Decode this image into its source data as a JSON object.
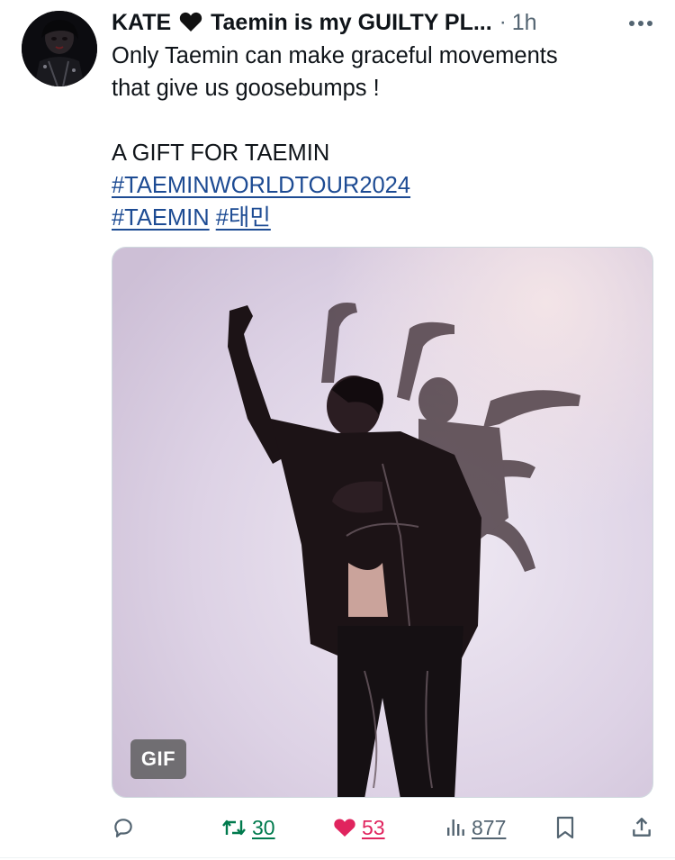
{
  "tweet": {
    "author_name_prefix": "KATE",
    "author_name_suffix": "Taemin is my GUILTY PL...",
    "separator": "·",
    "time": "1h",
    "text_line1": "Only Taemin can make graceful movements",
    "text_line2": "that give us goosebumps !",
    "text_line3": "A GIFT FOR TAEMIN",
    "hashtags": [
      "#TAEMINWORLDTOUR2024",
      "#TAEMIN",
      "#태민"
    ],
    "media_badge": "GIF"
  },
  "actions": {
    "replies": "",
    "retweets": "30",
    "likes": "53",
    "views": "877"
  },
  "icons": {
    "avatar": "avatar-image",
    "heart_emoji": "black-heart-icon",
    "more": "more-options-icon",
    "reply": "reply-icon",
    "retweet": "retweet-icon",
    "like": "heart-icon",
    "views": "views-icon",
    "bookmark": "bookmark-icon",
    "share": "share-icon"
  },
  "colors": {
    "hashtag": "#1d4b93",
    "retweet_active": "#007a4d",
    "like_active": "#e0245e",
    "secondary_text": "#536471"
  }
}
